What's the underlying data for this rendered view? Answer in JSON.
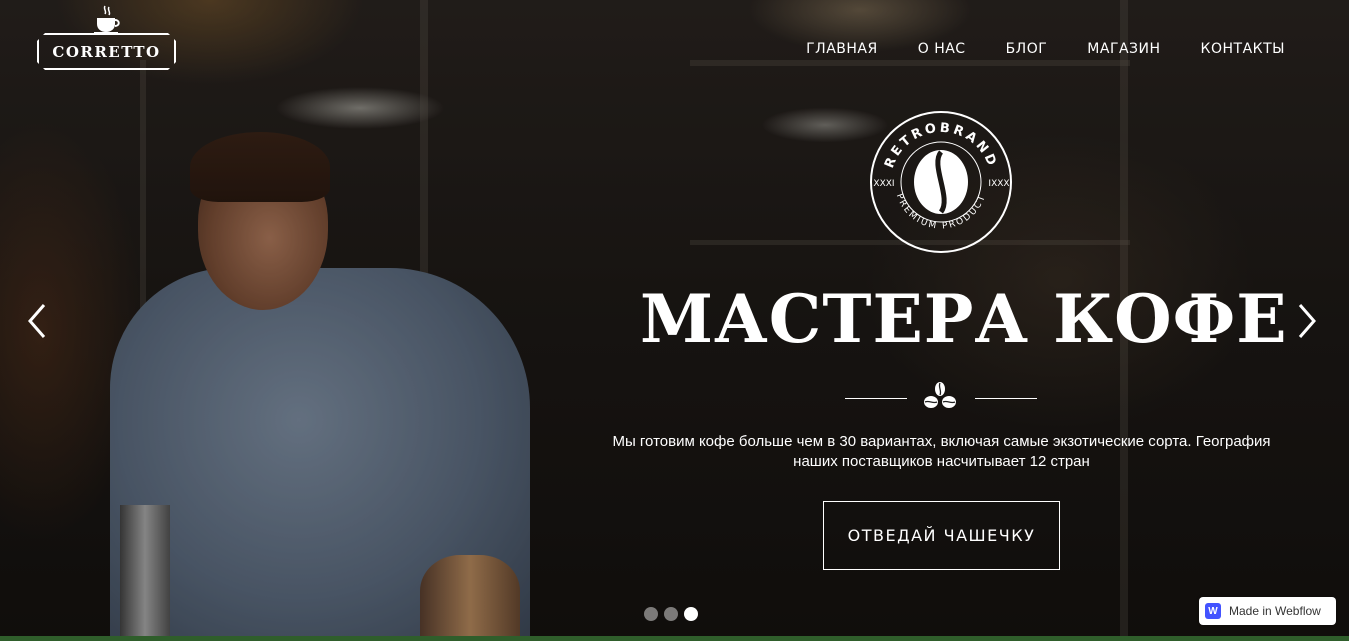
{
  "brand": {
    "logo_text": "CORRETTO"
  },
  "nav": {
    "items": [
      {
        "label": "ГЛАВНАЯ"
      },
      {
        "label": "О НАС"
      },
      {
        "label": "БЛОГ"
      },
      {
        "label": "МАГАЗИН"
      },
      {
        "label": "КОНТАКТЫ"
      }
    ]
  },
  "hero": {
    "badge": {
      "top_text": "RETROBRAND",
      "bottom_text": "PREMIUM PRODUCT",
      "left": "XXXI",
      "right": "IXXX"
    },
    "title": "МАСТЕРА КОФЕ",
    "subtitle": "Мы готовим кофе больше чем в 30 вариантах, включая самые экзотические сорта. География наших поставщиков насчитывает  12 стран",
    "cta_label": "ОТВЕДАЙ ЧАШЕЧКУ"
  },
  "slider": {
    "slide_count": 3,
    "active_index": 2
  },
  "badge_footer": {
    "label": "Made in Webflow"
  },
  "icons": {
    "prev": "chevron-left-icon",
    "next": "chevron-right-icon",
    "beans": "coffee-beans-icon",
    "cup": "coffee-cup-icon"
  }
}
